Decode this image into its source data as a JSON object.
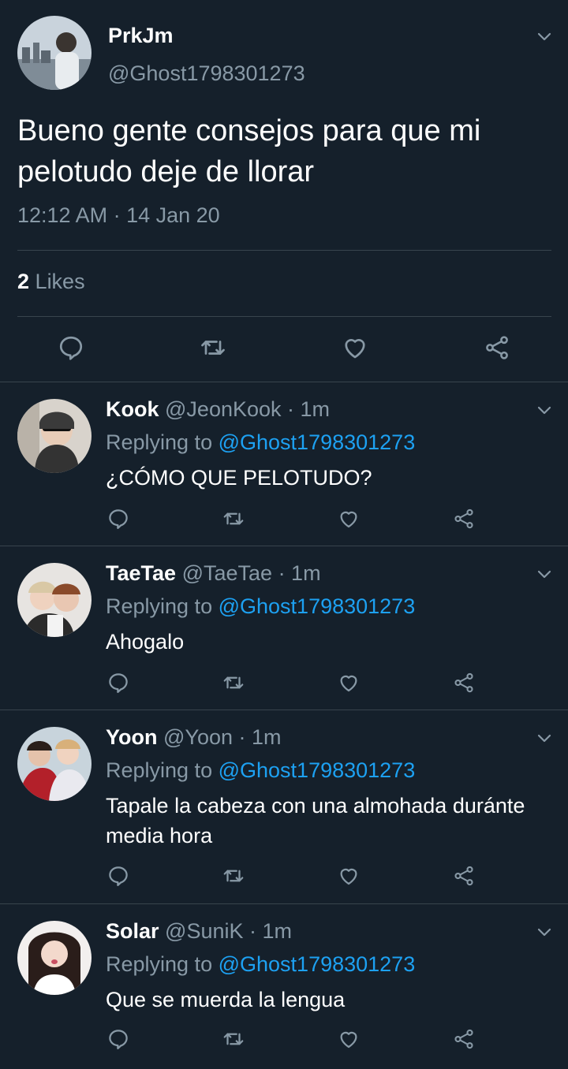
{
  "tweet": {
    "name": "PrkJm",
    "handle": "@Ghost1798301273",
    "text": "Bueno gente consejos para que mi pelotudo deje de llorar",
    "timestamp": "12:12 AM · 14 Jan 20",
    "likes_count": "2",
    "likes_label": "Likes"
  },
  "replies": [
    {
      "name": "Kook",
      "handle": "@JeonKook",
      "time": "· 1m",
      "replying_label": "Replying to",
      "replying_handle": "@Ghost1798301273",
      "text": "¿CÓMO QUE PELOTUDO?"
    },
    {
      "name": "TaeTae",
      "handle": "@TaeTae",
      "time": "· 1m",
      "replying_label": "Replying to",
      "replying_handle": "@Ghost1798301273",
      "text": "Ahogalo"
    },
    {
      "name": "Yoon",
      "handle": "@Yoon",
      "time": "· 1m",
      "replying_label": "Replying to",
      "replying_handle": "@Ghost1798301273",
      "text": "Tapale la cabeza con una almohada duránte media hora"
    },
    {
      "name": "Solar",
      "handle": "@SuniK",
      "time": "· 1m",
      "replying_label": "Replying to",
      "replying_handle": "@Ghost1798301273",
      "text": "Que se muerda la lengua"
    }
  ],
  "icons": {
    "reply": "reply-icon",
    "retweet": "retweet-icon",
    "like": "heart-icon",
    "share": "share-icon",
    "more": "chevron-down-icon"
  },
  "colors": {
    "background": "#15202b",
    "muted": "#8899a6",
    "accent": "#1da1f2",
    "divider": "#38444d"
  }
}
